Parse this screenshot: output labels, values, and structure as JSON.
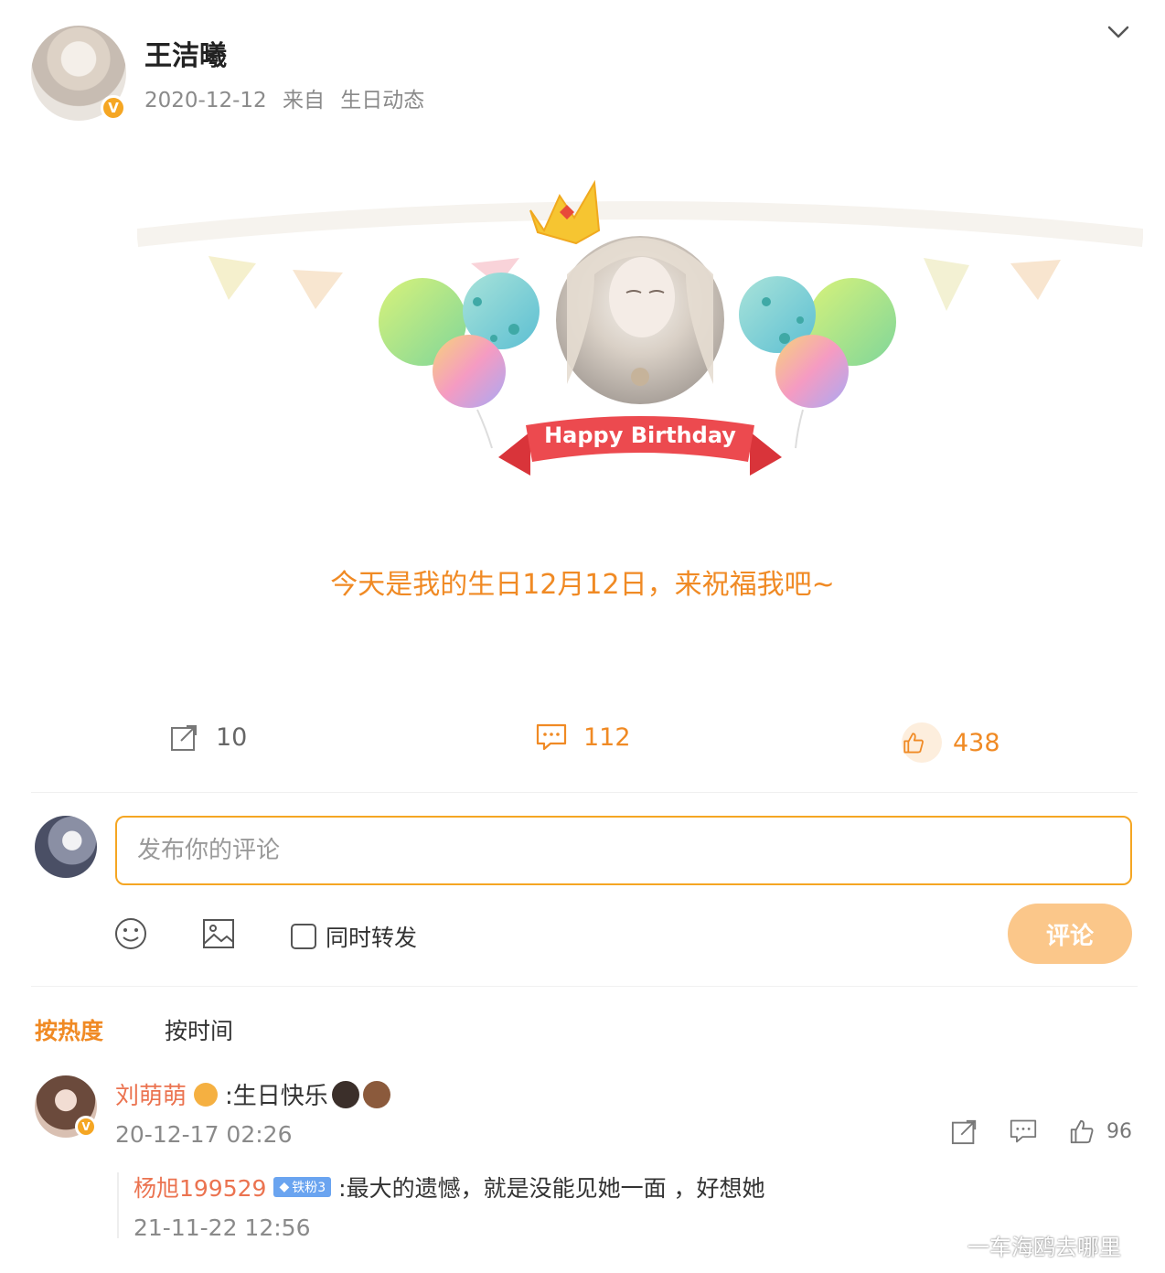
{
  "post": {
    "author": "王洁曦",
    "date": "2020-12-12",
    "source_prefix": "来自",
    "source": "生日动态",
    "banner_text": "Happy Birthday",
    "text": "今天是我的生日12月12日，来祝福我吧~"
  },
  "actions": {
    "repost_count": "10",
    "comment_count": "112",
    "like_count": "438"
  },
  "composer": {
    "placeholder": "发布你的评论",
    "repost_label": "同时转发",
    "submit_label": "评论"
  },
  "sort_tabs": {
    "hot": "按热度",
    "time": "按时间"
  },
  "comments": [
    {
      "user": "刘萌萌",
      "text": ":生日快乐",
      "time": "20-12-17 02:26",
      "likes": "96"
    }
  ],
  "replies": [
    {
      "user": "杨旭199529",
      "badge": "铁粉3",
      "text": ":最大的遗憾，就是没能见她一面  ，好想她",
      "time": "21-11-22 12:56"
    }
  ],
  "watermark": "一车海鸥去哪里",
  "colors": {
    "accent": "#f08a24",
    "comment_name": "#eb7350",
    "submit_button": "#fbc78a",
    "verified_badge": "#f5a623"
  }
}
